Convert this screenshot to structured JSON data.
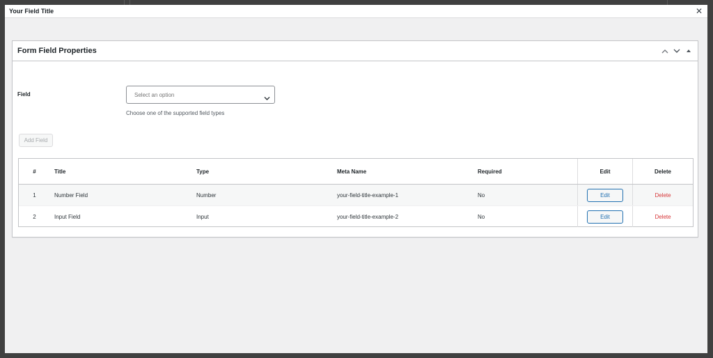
{
  "modal": {
    "title": "Your Field Title",
    "close_symbol": "✕"
  },
  "postbox": {
    "title": "Form Field Properties",
    "actions": [
      "chevron-up-icon",
      "chevron-down-icon",
      "triangle-up-icon"
    ]
  },
  "form": {
    "field_label": "Field",
    "select_placeholder": "Select an option",
    "description": "Choose one of the supported field types",
    "add_button": "Add Field"
  },
  "table": {
    "headers": {
      "num": "#",
      "title": "Title",
      "type": "Type",
      "meta": "Meta Name",
      "required": "Required",
      "edit": "Edit",
      "delete": "Delete"
    },
    "rows": [
      {
        "num": "1",
        "title": "Number Field",
        "type": "Number",
        "meta": "your-field-title-example-1",
        "required": "No",
        "edit": "Edit",
        "delete": "Delete"
      },
      {
        "num": "2",
        "title": "Input Field",
        "type": "Input",
        "meta": "your-field-title-example-2",
        "required": "No",
        "edit": "Edit",
        "delete": "Delete"
      }
    ]
  },
  "colors": {
    "accent": "#2271b1",
    "delete": "#d63638",
    "backdrop": "#404040",
    "panel": "#f0f0f1"
  }
}
